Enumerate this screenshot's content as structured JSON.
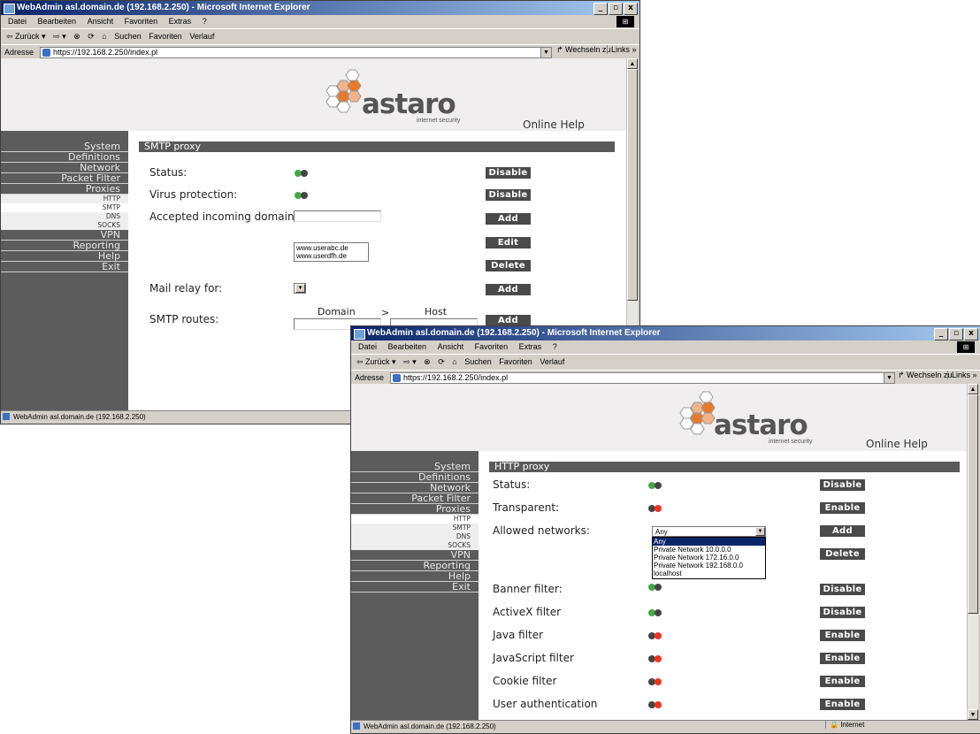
{
  "browser": {
    "menu": [
      "Datei",
      "Bearbeiten",
      "Ansicht",
      "Favoriten",
      "Extras",
      "?"
    ],
    "toolbar": [
      "⇦ Zurück ▾",
      "⇨ ▾",
      "⊗",
      "⟳",
      "⌂",
      "Suchen",
      "Favoriten",
      "Verlauf"
    ],
    "address_label": "Adresse",
    "address_value": "https://192.168.2.250/index.pl",
    "goto_label": "Wechseln zu",
    "links_label": "Links »",
    "window_buttons": [
      "_",
      "▫",
      "x"
    ]
  },
  "window_back": {
    "title": "WebAdmin asl.domain.de (192.168.2.250) - Microsoft Internet Explorer",
    "status_text": "WebAdmin asl.domain.de (192.168.2.250)"
  },
  "window_front": {
    "title": "WebAdmin asl.domain.de (192.168.2.250) - Microsoft Internet Explorer",
    "status_text": "WebAdmin asl.domain.de (192.168.2.250)",
    "zone_text": "Internet"
  },
  "brand": {
    "wordmark": "astaro",
    "tagline": "internet security",
    "online_help": "Online Help",
    "colors": {
      "orange": "#e87a2a",
      "sidebar": "#5c5c5c",
      "button": "#4a4a4a"
    }
  },
  "nav": {
    "main": [
      "System",
      "Definitions",
      "Network",
      "Packet Filter",
      "Proxies"
    ],
    "proxies_sub": [
      "HTTP",
      "SMTP",
      "DNS",
      "SOCKS"
    ],
    "rest": [
      "VPN",
      "Reporting",
      "Help",
      "Exit"
    ]
  },
  "smtp": {
    "title": "SMTP proxy",
    "status_label": "Status:",
    "virus_label": "Virus protection:",
    "domains_label": "Accepted incoming domains:",
    "domains_list": [
      "www.userabc.de",
      "www.userdfh.de"
    ],
    "relay_label": "Mail relay for:",
    "routes_label": "SMTP routes:",
    "routes_domain_hdr": "Domain",
    "routes_arrow": ">",
    "routes_host_hdr": "Host",
    "btn_disable": "Disable",
    "btn_add": "Add",
    "btn_edit": "Edit",
    "btn_delete": "Delete"
  },
  "http": {
    "title": "HTTP proxy",
    "status_label": "Status:",
    "transparent_label": "Transparent:",
    "allowed_label": "Allowed networks:",
    "allowed_selected": "Any",
    "allowed_options": [
      "Any",
      "Private Network 10.0.0.0",
      "Private Network 172.16.0.0",
      "Private Network 192.168.0.0",
      "localhost"
    ],
    "banner_label": "Banner filter:",
    "activex_label": "ActiveX filter",
    "java_label": "Java filter",
    "javascript_label": "JavaScript filter",
    "cookie_label": "Cookie filter",
    "userauth_label": "User authentication",
    "btn_disable": "Disable",
    "btn_enable": "Enable",
    "btn_add": "Add",
    "btn_delete": "Delete"
  }
}
